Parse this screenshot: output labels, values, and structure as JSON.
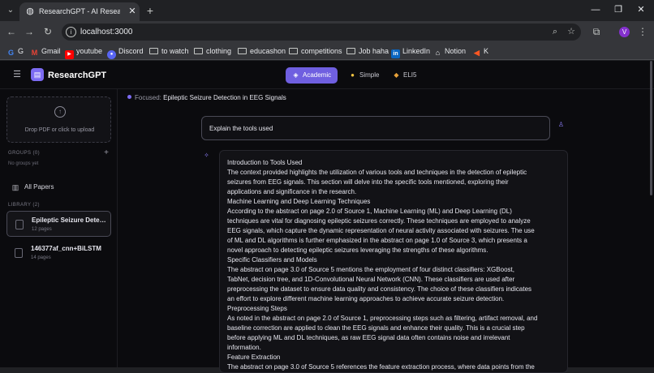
{
  "browser": {
    "tab": {
      "title": "ResearchGPT - AI Research Paper Assistant"
    },
    "address": {
      "url": "localhost:3000"
    },
    "bookmarks": [
      {
        "label": "G",
        "icon": "google-icon",
        "color": "#4285f4"
      },
      {
        "label": "Gmail",
        "icon": "gmail-icon",
        "color": "#ea4335"
      },
      {
        "label": "youtube",
        "icon": "youtube-icon",
        "color": "#ff0000"
      },
      {
        "label": "Discord",
        "icon": "discord-icon",
        "color": "#5865f2"
      },
      {
        "label": "to watch",
        "icon": "folder-icon"
      },
      {
        "label": "clothing",
        "icon": "folder-icon"
      },
      {
        "label": "educashon",
        "icon": "folder-icon"
      },
      {
        "label": "competitions",
        "icon": "folder-icon"
      },
      {
        "label": "Job haha",
        "icon": "folder-icon"
      },
      {
        "label": "LinkedIn",
        "icon": "linkedin-icon",
        "color": "#0a66c2"
      },
      {
        "label": "Notion",
        "icon": "notion-icon"
      },
      {
        "label": "K",
        "icon": "k-icon",
        "color": "#ff5722"
      }
    ],
    "profile_initial": "V"
  },
  "app": {
    "brand": "ResearchGPT",
    "accent_color": "#6f5fe0",
    "modes": [
      {
        "label": "Academic",
        "active": true,
        "icon": "graduation-cap-icon"
      },
      {
        "label": "Simple",
        "active": false,
        "icon": "lightbulb-icon"
      },
      {
        "label": "ELI5",
        "active": false,
        "icon": "shield-icon"
      }
    ]
  },
  "sidebar": {
    "upload_text": "Drop PDF or click to upload",
    "groups_title": "GROUPS (0)",
    "no_groups_text": "No groups yet",
    "all_papers_label": "All Papers",
    "library_title": "LIBRARY (2)",
    "papers": [
      {
        "title": "Epileptic Seizure Detection in EEG Signals",
        "pages": "12 pages",
        "active": true
      },
      {
        "title": "146377af_cnn+BiLSTM",
        "pages": "14 pages",
        "active": false
      }
    ]
  },
  "chat": {
    "focused_label": "Focused:",
    "focused_value": "Epileptic Seizure Detection in EEG Signals",
    "user_message": "Explain the tools used",
    "answer_lines": [
      "Introduction to Tools Used",
      "The context provided highlights the utilization of various tools and techniques in the detection of epileptic",
      "seizures from EEG signals. This section will delve into the specific tools mentioned, exploring their",
      "applications and significance in the research.",
      "Machine Learning and Deep Learning Techniques",
      "According to the abstract on page 2.0 of Source 1, Machine Learning (ML) and Deep Learning (DL)",
      "techniques are vital for diagnosing epileptic seizures correctly. These techniques are employed to analyze",
      "EEG signals, which capture the dynamic representation of neural activity associated with seizures. The use",
      "of ML and DL algorithms is further emphasized in the abstract on page 1.0 of Source 3, which presents a",
      "novel approach to detecting epileptic seizures leveraging the strengths of these algorithms.",
      "Specific Classifiers and Models",
      "The abstract on page 3.0 of Source 5 mentions the employment of four distinct classifiers: XGBoost,",
      "TabNet, decision tree, and 1D-Convolutional Neural Network (CNN). These classifiers are used after",
      "preprocessing the dataset to ensure data quality and consistency. The choice of these classifiers indicates",
      "an effort to explore different machine learning approaches to achieve accurate seizure detection.",
      "Preprocessing Steps",
      "As noted in the abstract on page 2.0 of Source 1, preprocessing steps such as filtering, artifact removal, and",
      "baseline correction are applied to clean the EEG signals and enhance their quality. This is a crucial step",
      "before applying ML and DL techniques, as raw EEG signal data often contains noise and irrelevant",
      "information.",
      "Feature Extraction",
      "The abstract on page 3.0 of Source 5 references the feature extraction process, where data points from the"
    ]
  }
}
